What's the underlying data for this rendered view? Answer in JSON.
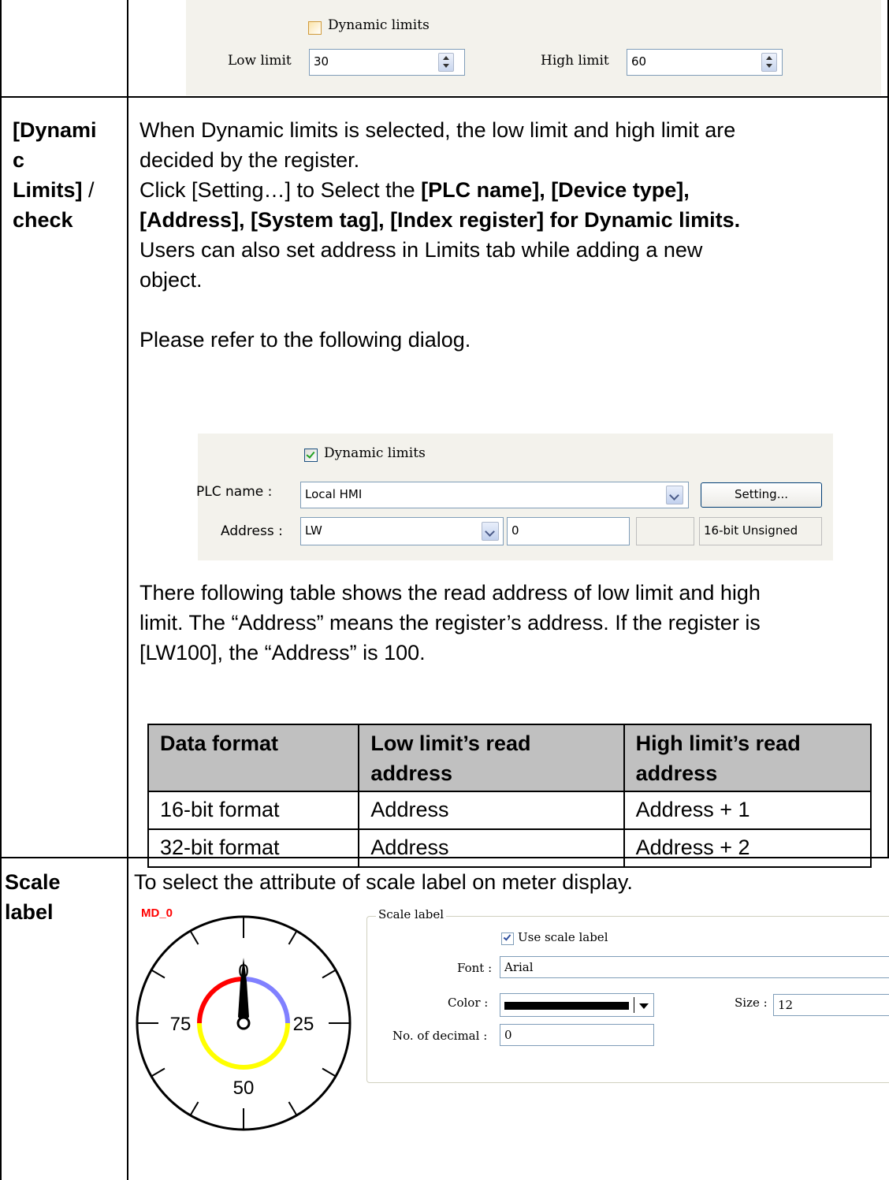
{
  "top_dialog": {
    "dynamic_limits_label": "Dynamic limits",
    "low_limit_label": "Low limit",
    "low_limit_value": "30",
    "high_limit_label": "High limit",
    "high_limit_value": "60"
  },
  "row_dynamic": {
    "title_lines": [
      "[Dynami",
      "c",
      "Limits]",
      "/",
      "check"
    ],
    "para1": [
      "When Dynamic limits is selected, the low limit and high limit are",
      "decided by the register."
    ],
    "para2_start": "Click [Setting…] to Select the ",
    "para2_bold1": "[PLC name], [Device type],",
    "para2_bold2": "[Address], [System tag], [Index register] for Dynamic limits.",
    "para3": [
      "Users can also set address in Limits tab while adding a new",
      "object."
    ],
    "para4": "Please refer to the following dialog.",
    "dialog": {
      "dynamic_limits_label": "Dynamic limits",
      "plc_name_label": "PLC name :",
      "plc_name_value": "Local HMI",
      "setting_button": "Setting...",
      "address_label": "Address :",
      "address_device": "LW",
      "address_value": "0",
      "data_type": "16-bit Unsigned"
    },
    "para5": [
      "There following table shows the read address of low limit and high",
      "limit. The “Address” means the register’s address. If the register is",
      "[LW100], the “Address” is 100."
    ],
    "table": {
      "headers": [
        [
          "Data format",
          ""
        ],
        [
          "Low limit’s read",
          "address"
        ],
        [
          "High limit’s read",
          "address"
        ]
      ],
      "rows": [
        [
          "16-bit format",
          "Address",
          "Address + 1"
        ],
        [
          "32-bit format",
          "Address",
          "Address + 2"
        ]
      ]
    }
  },
  "row_scale": {
    "title_lines": [
      "Scale",
      "label"
    ],
    "description": "To select the attribute of scale label on meter display.",
    "meter": {
      "name": "MD_0",
      "labels": [
        "0",
        "25",
        "50",
        "75"
      ]
    },
    "dialog": {
      "group_label": "Scale label",
      "use_scale_label": "Use scale label",
      "font_label": "Font :",
      "font_value": "Arial",
      "color_label": "Color :",
      "size_label": "Size :",
      "size_value": "12",
      "decimal_label": "No. of decimal :",
      "decimal_value": "0"
    }
  },
  "colors": {
    "header_gray": "#c0c0c0",
    "dialog_bg": "#f3f2ec",
    "meter_red": "#ff0000",
    "meter_yellow": "#ffff00",
    "meter_blue": "#8080ff",
    "meter_label_red": "#ff0000"
  }
}
